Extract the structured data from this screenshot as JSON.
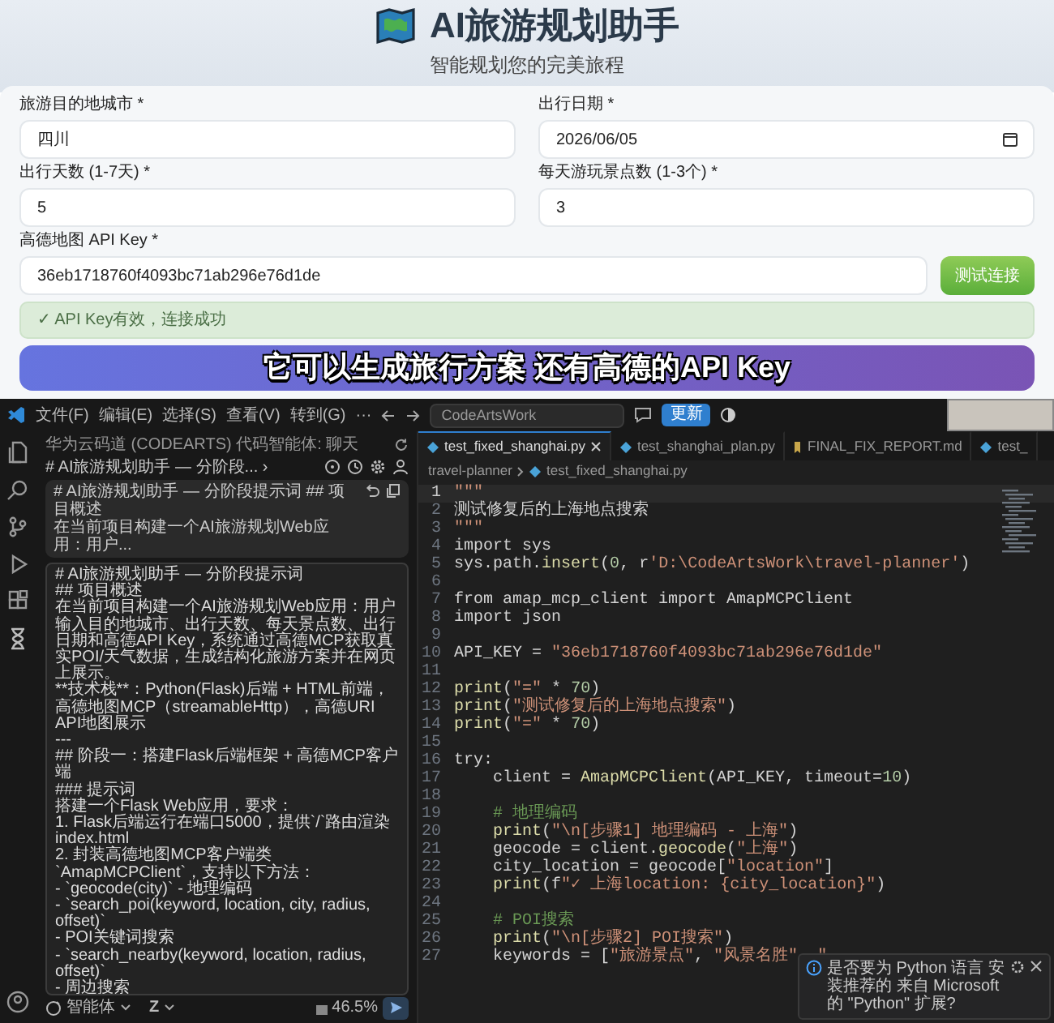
{
  "header": {
    "title": "AI旅游规划助手",
    "subtitle": "智能规划您的完美旅程"
  },
  "form": {
    "fields": [
      {
        "label": "旅游目的地城市 *",
        "value": "四川",
        "kind": "text"
      },
      {
        "label": "出行日期 *",
        "value": "2026/06/05",
        "kind": "date"
      },
      {
        "label": "出行天数 (1-7天) *",
        "value": "5",
        "kind": "text"
      },
      {
        "label": "每天游玩景点数 (1-3个) *",
        "value": "3",
        "kind": "text"
      },
      {
        "label": "高德地图 API Key *",
        "value": "36eb1718760f4093bc71ab296e76d1de",
        "kind": "key"
      }
    ],
    "test_button": "测试连接",
    "alert": "✓ API Key有效，连接成功"
  },
  "caption": "它可以生成旅行方案 还有高德的API Key",
  "ide": {
    "menus": [
      "文件(F)",
      "编辑(E)",
      "选择(S)",
      "查看(V)",
      "转到(G)",
      "···"
    ],
    "search": "CodeArtsWork",
    "update_button": "更新",
    "chat": {
      "title": "华为云码道 (CODEARTS) 代码智能体: 聊天",
      "session": "# AI旅游规划助手 — 分阶段... ›",
      "prompt": [
        "# AI旅游规划助手 — 分阶段提示词 ## 项目概述",
        "在当前项目构建一个AI旅游规划Web应用：用户..."
      ],
      "tooltip": [
        "# AI旅游规划助手 — 分阶段提示词",
        "## 项目概述",
        "在当前项目构建一个AI旅游规划Web应用：用户输入目的地城市、出行天数、每天景点数、出行日期和高德API Key，系统通过高德MCP获取真实POI/天气数据，生成结构化旅游方案并在网页上展示。",
        "**技术栈**：Python(Flask)后端 + HTML前端，高德地图MCP（streamableHttp），高德URI API地图展示",
        "---",
        "## 阶段一：搭建Flask后端框架 + 高德MCP客户端",
        "### 提示词",
        "搭建一个Flask Web应用，要求：",
        "1. Flask后端运行在端口5000，提供`/`路由渲染index.html",
        "2. 封装高德地图MCP客户端类`AmapMCPClient`，支持以下方法：",
        "- `geocode(city)` - 地理编码",
        "- `search_poi(keyword, location, city, radius, offset)`",
        "- POI关键词搜索",
        "- `search_nearby(keyword, location, radius, offset)`",
        "- 周边搜索"
      ],
      "mode": "智能体",
      "model": "Z",
      "usage": "46.5%"
    },
    "tabs": [
      {
        "label": "test_fixed_shanghai.py",
        "selected": true,
        "kind": "py"
      },
      {
        "label": "test_shanghai_plan.py",
        "selected": false,
        "kind": "py"
      },
      {
        "label": "FINAL_FIX_REPORT.md",
        "selected": false,
        "kind": "md"
      },
      {
        "label": "test_",
        "selected": false,
        "kind": "py"
      }
    ],
    "breadcrumb": [
      "travel-planner",
      "test_fixed_shanghai.py"
    ],
    "code": [
      {
        "n": "1",
        "text": "\"\"\"",
        "current": true
      },
      {
        "n": "2",
        "text": "测试修复后的上海地点搜索",
        "current": false
      },
      {
        "n": "3",
        "text": "\"\"\"",
        "current": false
      },
      {
        "n": "4",
        "text": "import sys",
        "current": false
      },
      {
        "n": "5",
        "text": "sys.path.insert(0, r'D:\\CodeArtsWork\\travel-planner')",
        "current": false
      },
      {
        "n": "6",
        "current": false
      },
      {
        "n": "7",
        "text": "from amap_mcp_client import AmapMCPClient",
        "current": false
      },
      {
        "n": "8",
        "text": "import json",
        "current": false
      },
      {
        "n": "9",
        "current": false
      },
      {
        "n": "10",
        "text": "API_KEY = \"36eb1718760f4093bc71ab296e76d1de\"",
        "current": false
      },
      {
        "n": "11",
        "current": false
      },
      {
        "n": "12",
        "text": "print(\"=\" * 70)",
        "current": false
      },
      {
        "n": "13",
        "text": "print(\"测试修复后的上海地点搜索\")",
        "current": false
      },
      {
        "n": "14",
        "text": "print(\"=\" * 70)",
        "current": false
      },
      {
        "n": "15",
        "current": false
      },
      {
        "n": "16",
        "text": "try:",
        "current": false
      },
      {
        "n": "17",
        "text": "    client = AmapMCPClient(API_KEY, timeout=10)",
        "current": false
      },
      {
        "n": "18",
        "current": false
      },
      {
        "n": "19",
        "text": "    # 地理编码",
        "current": false
      },
      {
        "n": "20",
        "text": "    print(\"\\n[步骤1] 地理编码 - 上海\")",
        "current": false
      },
      {
        "n": "21",
        "text": "    geocode = client.geocode(\"上海\")",
        "current": false
      },
      {
        "n": "22",
        "text": "    city_location = geocode[\"location\"]",
        "current": false
      },
      {
        "n": "23",
        "text": "    print(f\"✓ 上海location: {city_location}\")",
        "current": false
      },
      {
        "n": "24",
        "current": false
      },
      {
        "n": "25",
        "text": "    # POI搜索",
        "current": false
      },
      {
        "n": "26",
        "text": "    print(\"\\n[步骤2] POI搜索\")",
        "current": false
      },
      {
        "n": "27",
        "text": "    keywords = [\"旅游景点\", \"风景名胜\", \"",
        "current": false
      }
    ],
    "notification": "是否要为 Python 语言 安装推荐的 来自 Microsoft 的 \"Python\" 扩展?"
  }
}
